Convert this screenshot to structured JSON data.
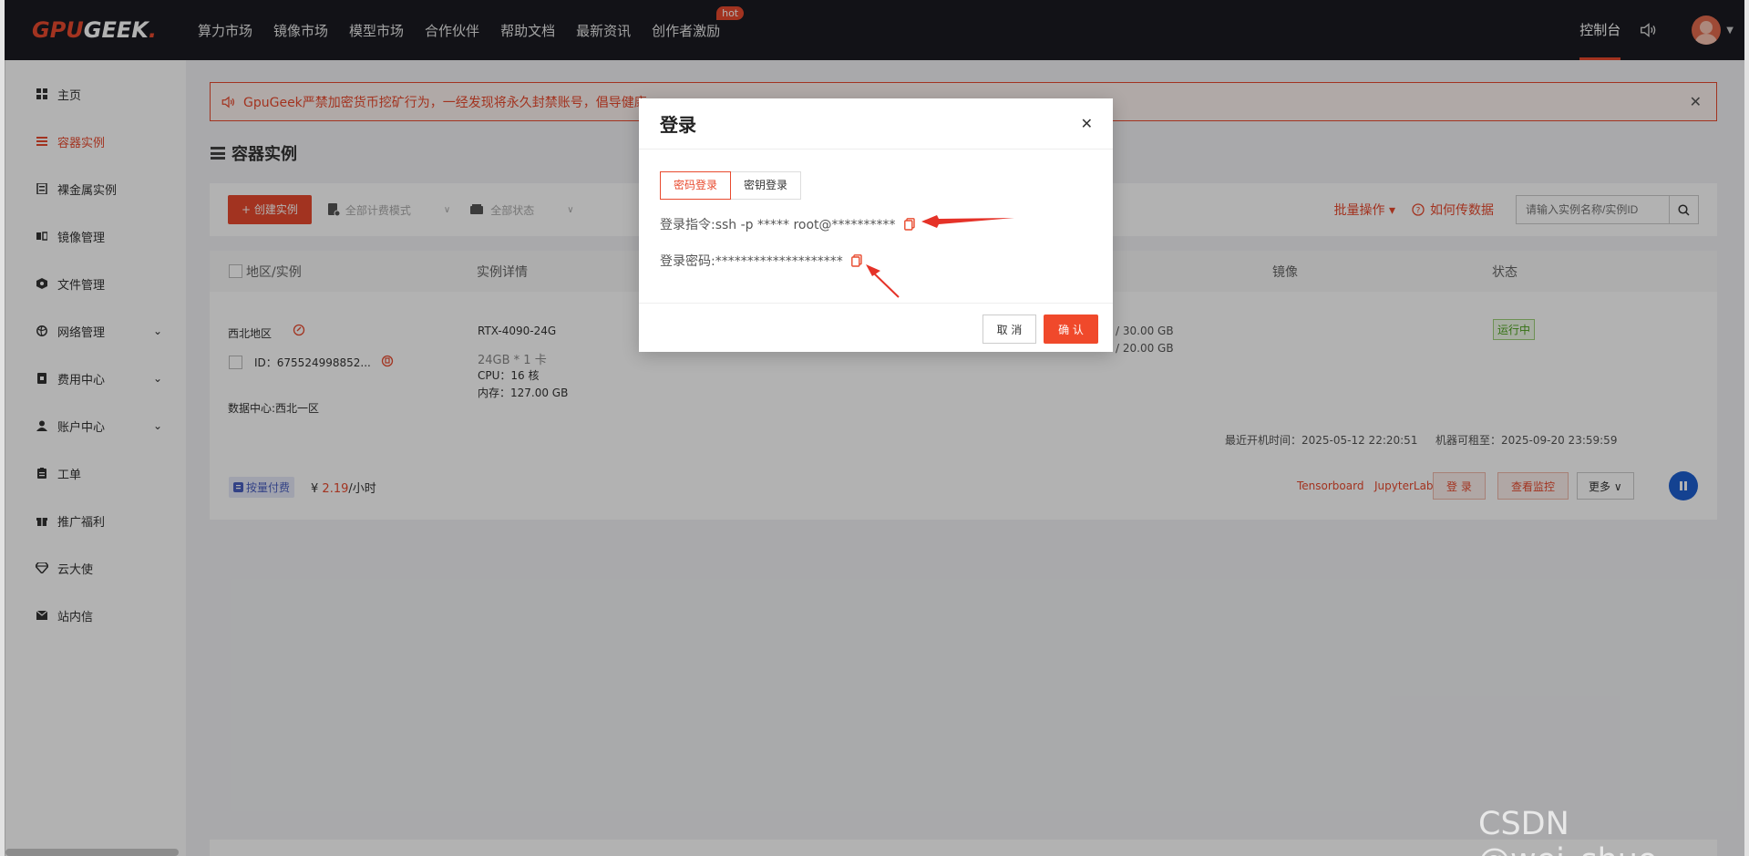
{
  "brand": {
    "logo_gpu": "GPU",
    "logo_geek": "GEEK",
    "logo_dot": "."
  },
  "topnav": {
    "items": [
      "算力市场",
      "镜像市场",
      "模型市场",
      "合作伙伴",
      "帮助文档",
      "最新资讯",
      "创作者激励"
    ],
    "hot_badge": "hot",
    "console": "控制台"
  },
  "sidebar": {
    "items": [
      {
        "label": "主页",
        "icon": "grid-icon"
      },
      {
        "label": "容器实例",
        "icon": "list-icon"
      },
      {
        "label": "裸金属实例",
        "icon": "server-icon"
      },
      {
        "label": "镜像管理",
        "icon": "image-icon"
      },
      {
        "label": "文件管理",
        "icon": "folder-icon"
      },
      {
        "label": "网络管理",
        "icon": "globe-icon"
      },
      {
        "label": "费用中心",
        "icon": "wallet-icon"
      },
      {
        "label": "账户中心",
        "icon": "user-icon"
      },
      {
        "label": "工单",
        "icon": "ticket-icon"
      },
      {
        "label": "推广福利",
        "icon": "gift-icon"
      },
      {
        "label": "云大使",
        "icon": "diamond-icon"
      },
      {
        "label": "站内信",
        "icon": "mail-icon"
      }
    ]
  },
  "alert": {
    "text": "GpuGeek严禁加密货币挖矿行为，一经发现将永久封禁账号，倡导健康"
  },
  "page": {
    "title": "容器实例"
  },
  "toolbar": {
    "create": "+ 创建实例",
    "billing_filter": "全部计费模式",
    "status_filter": "全部状态",
    "batch": "批量操作 ▾",
    "howto": "如何传数据",
    "search_placeholder": "请输入实例名称/实例ID"
  },
  "table": {
    "headers": {
      "region": "地区/实例",
      "detail": "实例详情",
      "image": "镜像",
      "status": "状态"
    },
    "row": {
      "region": "西北地区",
      "id": "ID：675524998852...",
      "datacenter": "数据中心:西北一区",
      "gpu": "RTX-4090-24G",
      "gpu_mem": "24GB * 1 卡",
      "cpu": "CPU：16 核",
      "mem": "内存：127.00 GB",
      "disk1": "/ 30.00 GB",
      "disk2": "/ 20.00 GB",
      "status": "运行中",
      "last_boot": "最近开机时间：2025-05-12 22:20:51",
      "rent_until": "机器可租至：2025-09-20 23:59:59",
      "pay_tag": "按量付费",
      "price_prefix": "¥",
      "price": "2.19",
      "price_unit": "/小时",
      "tensorboard": "Tensorboard",
      "jupyter": "JupyterLab",
      "login": "登 录",
      "monitor": "查看监控",
      "more": "更多 ∨"
    }
  },
  "modal": {
    "title": "登录",
    "tabs": [
      "密码登录",
      "密钥登录"
    ],
    "command": "登录指令:ssh -p ***** root@**********",
    "password": "登录密码:********************",
    "cancel": "取 消",
    "ok": "确 认"
  },
  "watermark": "CSDN @wei_shuo",
  "colors": {
    "accent": "#e84a2e",
    "topbar": "#1a1b22",
    "pause": "#1d5fd0"
  }
}
